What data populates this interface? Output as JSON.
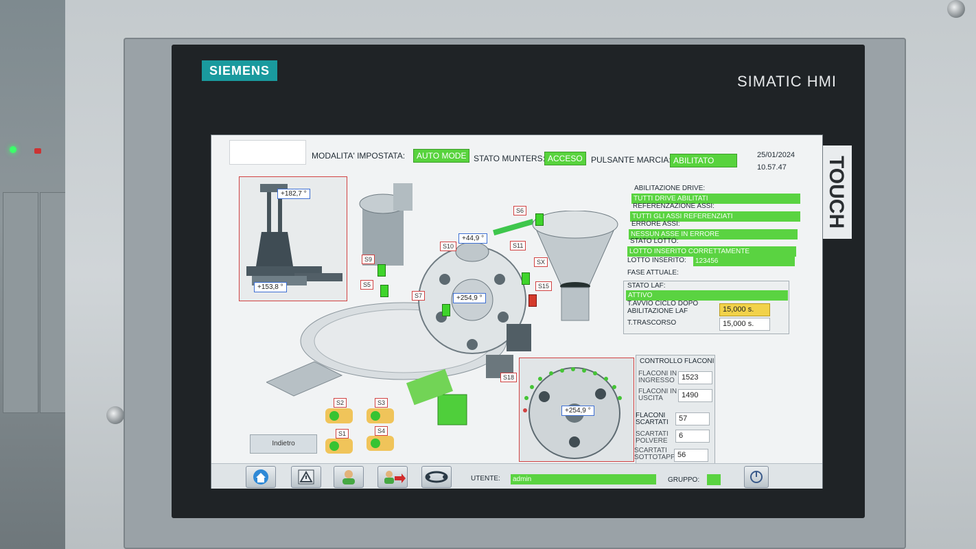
{
  "device": {
    "brand": "SIEMENS",
    "model": "SIMATIC HMI",
    "side_label": "TOUCH"
  },
  "header": {
    "modalita_label": "MODALITA' IMPOSTATA:",
    "modalita_value": "AUTO MODE",
    "munters_label": "STATO MUNTERS:",
    "munters_value": "ACCESO",
    "marcia_label": "PULSANTE MARCIA:",
    "marcia_value": "ABILITATO",
    "date": "25/01/2024",
    "time": "10.57.47"
  },
  "status_panel": {
    "drive_label": "ABILITAZIONE DRIVE:",
    "drive_value": "TUTTI DRIVE ABILITATI",
    "assi_label": "REFERENZAZIONE ASSI:",
    "assi_value": "TUTTI GLI ASSI REFERENZIATI",
    "errore_label": "ERRORE ASSI:",
    "errore_value": "NESSUN ASSE IN ERRORE",
    "lotto_label": "STATO LOTTO:",
    "lotto_value": "LOTTO INSERITO CORRETTAMENTE",
    "lotto_ins_label": "LOTTO INSERITO:",
    "lotto_ins_value": "123456",
    "fase_label": "FASE ATTUALE:"
  },
  "laf_panel": {
    "stato_label": "STATO LAF:",
    "stato_value": "ATTIVO",
    "avvio_label_1": "T.AVVIO CICLO DOPO",
    "avvio_label_2": "ABILITAZIONE LAF",
    "avvio_value": "15,000 s.",
    "trascorso_label": "T.TRASCORSO",
    "trascorso_value": "15,000 s."
  },
  "flaconi": {
    "title": "CONTROLLO FLACONI",
    "ingresso_label_1": "FLACONI IN",
    "ingresso_label_2": "INGRESSO",
    "ingresso_value": "1523",
    "uscita_label_1": "FLACONI IN",
    "uscita_label_2": "USCITA",
    "uscita_value": "1490",
    "scartati_label_1": "FLACONI",
    "scartati_label_2": "SCARTATI",
    "scartati_value": "57",
    "polvere_label_1": "SCARTATI",
    "polvere_label_2": "POLVERE",
    "polvere_value": "6",
    "sottotappi_label_1": "SCARTATI",
    "sottotappi_label_2": "SOTTOTAPPI",
    "sottotappi_value": "56"
  },
  "angles": {
    "a1": "+182,7 °",
    "a2": "+153,8 °",
    "a3": "+44,9 °",
    "a4": "+254,9 °",
    "a5": "+254,9 °"
  },
  "sensors": {
    "s6": "S6",
    "s9": "S9",
    "s10": "S10",
    "s11": "S11",
    "sx": "SX",
    "s5": "S5",
    "s7": "S7",
    "s15": "S15",
    "s18": "S18",
    "s2": "S2",
    "s3": "S3",
    "s1": "S1",
    "s4": "S4"
  },
  "footer": {
    "indietro": "Indietro",
    "utente_label": "UTENTE:",
    "utente_value": "admin",
    "gruppo_label": "GRUPPO:"
  },
  "colors": {
    "status_green": "#58d33d",
    "warning_yellow": "#f2d24a",
    "sensor_red": "#d14242",
    "brand_teal": "#1a9a9e"
  }
}
